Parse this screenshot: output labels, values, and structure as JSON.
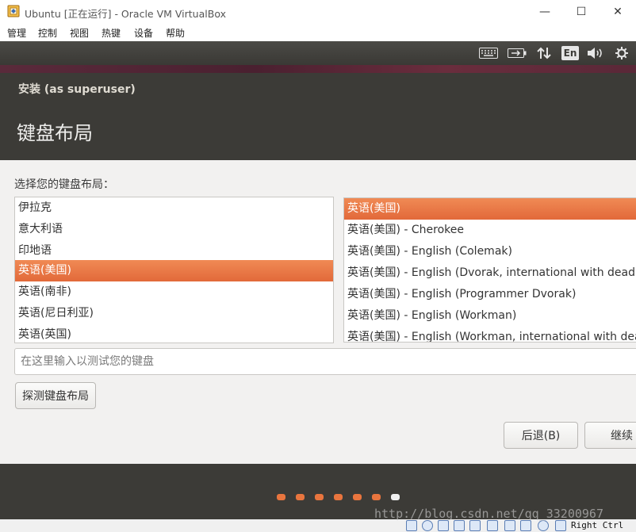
{
  "window": {
    "title": "Ubuntu [正在运行] - Oracle VM VirtualBox",
    "controls": {
      "minimize": "—",
      "maximize": "☐",
      "close": "✕"
    }
  },
  "menubar": [
    "管理",
    "控制",
    "视图",
    "热键",
    "设备",
    "帮助"
  ],
  "topbar": {
    "language_indicator": "En",
    "icons": [
      "keyboard-icon",
      "battery-icon",
      "network-icon",
      "language-indicator",
      "volume-icon",
      "settings-icon"
    ]
  },
  "installer": {
    "title": "安装 (as superuser)",
    "heading": "键盘布局",
    "choose_label": "选择您的键盘布局：",
    "layouts": [
      "伊拉克",
      "意大利语",
      "印地语",
      "英语(美国)",
      "英语(南非)",
      "英语(尼日利亚)",
      "英语(英国)"
    ],
    "selected_layout_index": 3,
    "variants": [
      "英语(美国)",
      "英语(美国) - Cherokee",
      "英语(美国) - English (Colemak)",
      "英语(美国) - English (Dvorak, international with dead keys)",
      "英语(美国) - English (Programmer Dvorak)",
      "英语(美国) - English (Workman)",
      "英语(美国) - English (Workman, international with dead keys)"
    ],
    "selected_variant_index": 0,
    "test_input": {
      "value": "",
      "placeholder": "在这里输入以测试您的键盘"
    },
    "detect_button": "探测键盘布局",
    "back_button": "后退(B)",
    "continue_button": "继续",
    "progress": {
      "total_steps": 7,
      "current_step": 7
    }
  },
  "statusbar": {
    "host_key": "Right Ctrl"
  },
  "watermark": "http://blog.csdn.net/qq_33200967",
  "colors": {
    "accent": "#e9753e",
    "header_bg": "#3c3b37",
    "content_bg": "#f2f1f0",
    "selection_text": "#ffffff"
  }
}
